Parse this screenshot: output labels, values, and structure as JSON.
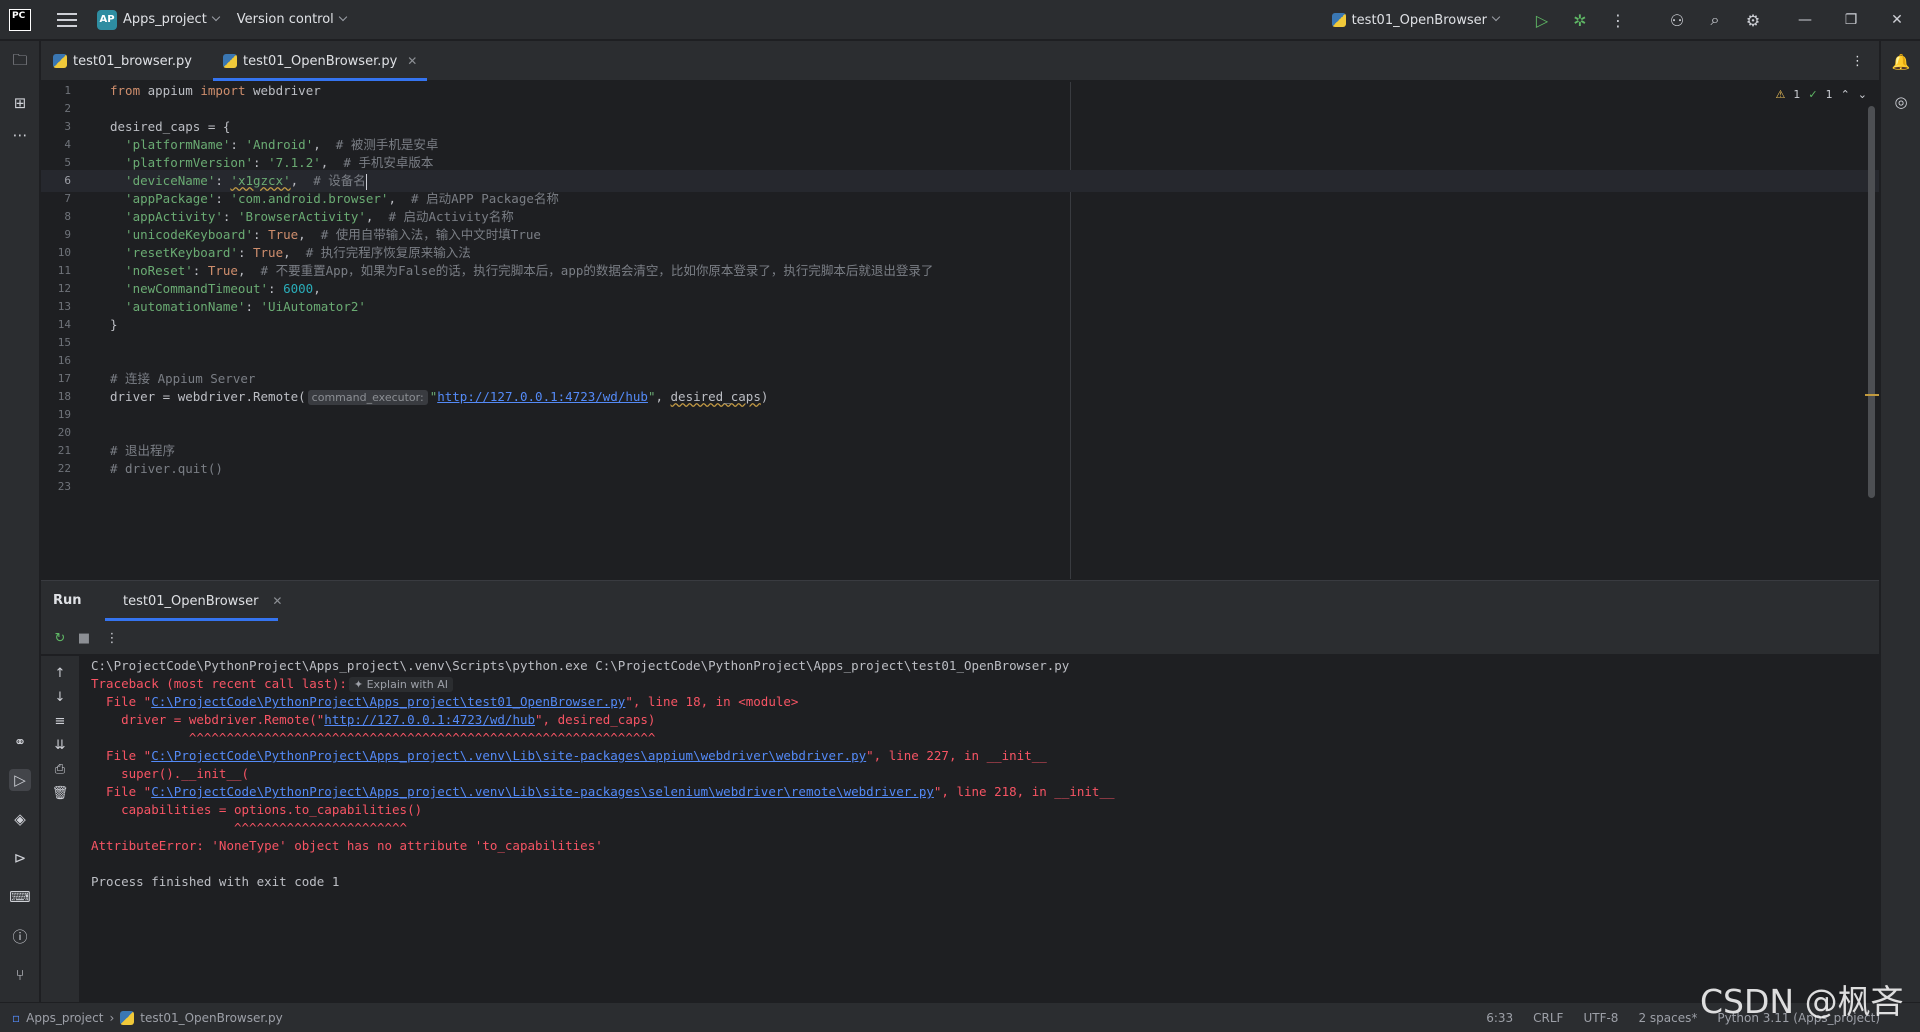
{
  "titlebar": {
    "logo": "PC",
    "project_badge": "AP",
    "project_name": "Apps_project",
    "vcs": "Version control",
    "run_config": "test01_OpenBrowser"
  },
  "editor_tabs": [
    {
      "label": "test01_browser.py"
    },
    {
      "label": "test01_OpenBrowser.py",
      "active": true
    }
  ],
  "inspections": {
    "warnings": "1",
    "ok": "1"
  },
  "editor": {
    "lines": [
      {
        "n": "1"
      },
      {
        "n": "2"
      },
      {
        "n": "3"
      },
      {
        "n": "4"
      },
      {
        "n": "5"
      },
      {
        "n": "6"
      },
      {
        "n": "7"
      },
      {
        "n": "8"
      },
      {
        "n": "9"
      },
      {
        "n": "10"
      },
      {
        "n": "11"
      },
      {
        "n": "12"
      },
      {
        "n": "13"
      },
      {
        "n": "14"
      },
      {
        "n": "15"
      },
      {
        "n": "16"
      },
      {
        "n": "17"
      },
      {
        "n": "18"
      },
      {
        "n": "19"
      },
      {
        "n": "20"
      },
      {
        "n": "21"
      },
      {
        "n": "22"
      },
      {
        "n": "23"
      }
    ],
    "code": {
      "l1_from": "from",
      "l1_mod": " appium ",
      "l1_import": "import",
      "l1_rest": " webdriver",
      "l3": "desired_caps = {",
      "l4_key": "  'platformName'",
      "l4_val": "'Android'",
      "l4_cm": "# 被测手机是安卓",
      "l5_key": "  'platformVersion'",
      "l5_val": "'7.1.2'",
      "l5_cm": "# 手机安卓版本",
      "l6_key": "  'deviceName'",
      "l6_val": "'x1gzcx'",
      "l6_cm": "# 设备名",
      "l7_key": "  'appPackage'",
      "l7_val": "'com.android.browser'",
      "l7_cm": "# 启动APP Package名称",
      "l8_key": "  'appActivity'",
      "l8_val": "'BrowserActivity'",
      "l8_cm": "# 启动Activity名称",
      "l9_key": "  'unicodeKeyboard'",
      "l9_val": "True",
      "l9_cm": "# 使用自带输入法，输入中文时填True",
      "l10_key": "  'resetKeyboard'",
      "l10_val": "True",
      "l10_cm": "# 执行完程序恢复原来输入法",
      "l11_key": "  'noReset'",
      "l11_val": "True",
      "l11_cm": "# 不要重置App，如果为False的话，执行完脚本后，app的数据会清空，比如你原本登录了，执行完脚本后就退出登录了",
      "l12_key": "  'newCommandTimeout'",
      "l12_val": "6000",
      "l13_key": "  'automationName'",
      "l13_val": "'UiAutomator2'",
      "l14": "}",
      "l17": "# 连接 Appium Server",
      "l18_pre": "driver = webdriver.Remote(",
      "l18_hint": "command_executor:",
      "l18_url": "http://127.0.0.1:4723/wd/hub",
      "l18_arg": "desired_caps",
      "l21": "# 退出程序",
      "l22": "# driver.quit()"
    }
  },
  "run_panel": {
    "title": "Run",
    "tab": "test01_OpenBrowser",
    "console": {
      "cmd": "C:\\ProjectCode\\PythonProject\\Apps_project\\.venv\\Scripts\\python.exe C:\\ProjectCode\\PythonProject\\Apps_project\\test01_OpenBrowser.py",
      "traceback": "Traceback (most recent call last):",
      "explain_ai": "Explain with AI",
      "f1_pre": "  File \"",
      "f1_path": "C:\\ProjectCode\\PythonProject\\Apps_project\\test01_OpenBrowser.py",
      "f1_post": "\", line 18, in <module>",
      "f1_code_pre": "    driver = webdriver.Remote(\"",
      "f1_code_url": "http://127.0.0.1:4723/wd/hub",
      "f1_code_post": "\", desired_caps)",
      "f1_carets": "             ^^^^^^^^^^^^^^^^^^^^^^^^^^^^^^^^^^^^^^^^^^^^^^^^^^^^^^^^^^^^^^",
      "f2_path": "C:\\ProjectCode\\PythonProject\\Apps_project\\.venv\\Lib\\site-packages\\appium\\webdriver\\webdriver.py",
      "f2_post": "\", line 227, in __init__",
      "f2_code": "    super().__init__(",
      "f3_path": "C:\\ProjectCode\\PythonProject\\Apps_project\\.venv\\Lib\\site-packages\\selenium\\webdriver\\remote\\webdriver.py",
      "f3_post": "\", line 218, in __init__",
      "f3_code": "    capabilities = options.to_capabilities()",
      "f3_carets": "                   ^^^^^^^^^^^^^^^^^^^^^^^",
      "error": "AttributeError: 'NoneType' object has no attribute 'to_capabilities'",
      "finished": "Process finished with exit code 1"
    }
  },
  "statusbar": {
    "project": "Apps_project",
    "file": "test01_OpenBrowser.py",
    "position": "6:33",
    "line_sep": "CRLF",
    "encoding": "UTF-8",
    "indent": "2 spaces*",
    "interpreter": "Python 3.11 (Apps_project)"
  },
  "watermark": "CSDN @枫吝"
}
